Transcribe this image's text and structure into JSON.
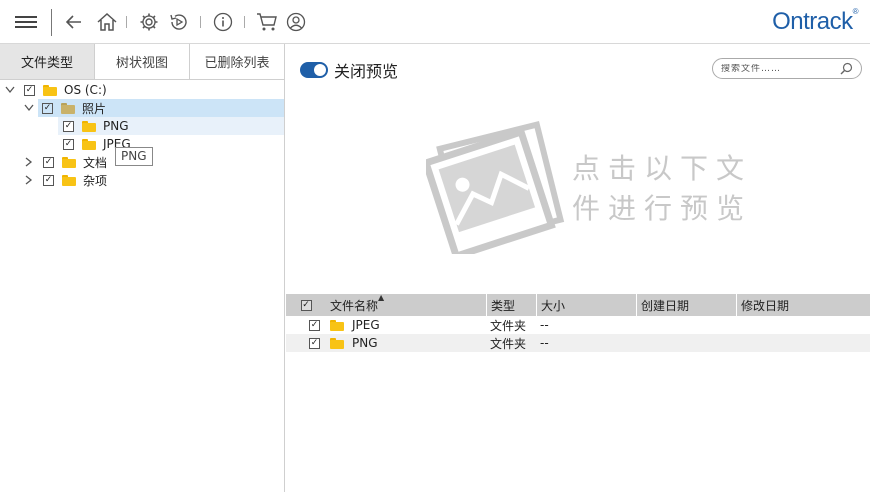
{
  "app": {
    "brand": "Ontrack",
    "brand_mark": "®"
  },
  "toolbar": {
    "items": [
      "menu-icon",
      "back-icon",
      "home-icon",
      "settings-icon",
      "restore-icon",
      "info-icon",
      "cart-icon",
      "account-icon"
    ]
  },
  "left_tabs": [
    {
      "label": "文件类型",
      "active": true
    },
    {
      "label": "树状视图",
      "active": false
    },
    {
      "label": "已删除列表",
      "active": false
    }
  ],
  "tree": {
    "root": {
      "label": "OS (C:)",
      "checked": true
    },
    "photos": {
      "label": "照片",
      "checked": true
    },
    "png": {
      "label": "PNG",
      "checked": true
    },
    "jpeg": {
      "label": "JPEG",
      "checked": true
    },
    "docs": {
      "label": "文档",
      "checked": true
    },
    "misc": {
      "label": "杂项",
      "checked": true
    }
  },
  "tooltip": {
    "text": "PNG"
  },
  "preview": {
    "toggle_label": "关闭预览",
    "toggle_on": true,
    "search_placeholder": "搜索文件……",
    "hint_line1": "点击以下文",
    "hint_line2": "件进行预览"
  },
  "table": {
    "columns": [
      "文件名称",
      "类型",
      "大小",
      "创建日期",
      "修改日期"
    ],
    "rows": [
      {
        "name": "JPEG",
        "type": "文件夹",
        "size": "--",
        "created": "",
        "modified": ""
      },
      {
        "name": "PNG",
        "type": "文件夹",
        "size": "--",
        "created": "",
        "modified": ""
      }
    ]
  },
  "colors": {
    "accent": "#1f5fa8",
    "selection": "#cce4f7",
    "folder": "#f8c315",
    "header_bg": "#cccccc"
  }
}
